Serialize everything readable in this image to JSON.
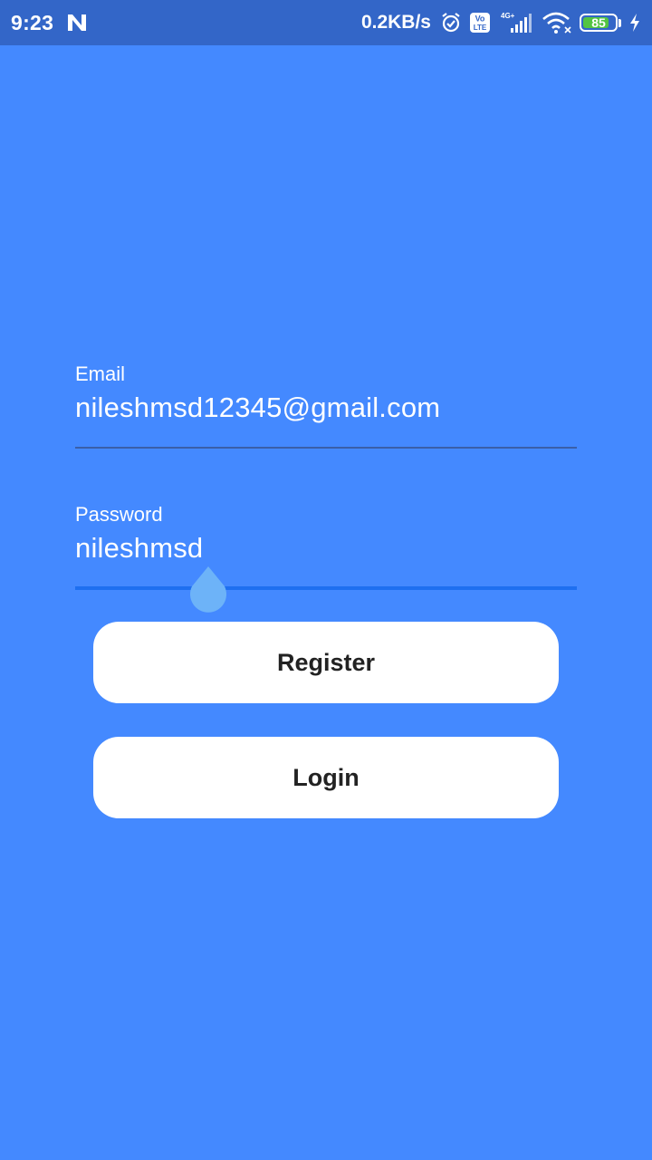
{
  "status_bar": {
    "time": "9:23",
    "notification_icon": "n-notification-icon",
    "net_speed": "0.2KB/s",
    "network_type": "4G+",
    "volte_top": "Vo",
    "volte_bottom": "LTE",
    "battery_level": "85",
    "battery_fraction": 0.85,
    "colors": {
      "bar": "#3366C8",
      "battery": "#53C441"
    }
  },
  "form": {
    "email": {
      "label": "Email",
      "value": "nileshmsd12345@gmail.com"
    },
    "password": {
      "label": "Password",
      "value": "nileshmsd"
    }
  },
  "buttons": {
    "register_label": "Register",
    "login_label": "Login"
  },
  "colors": {
    "background": "#4489FF",
    "focused_underline": "#1E6FF0",
    "cursor_handle": "#6DB3F8"
  }
}
